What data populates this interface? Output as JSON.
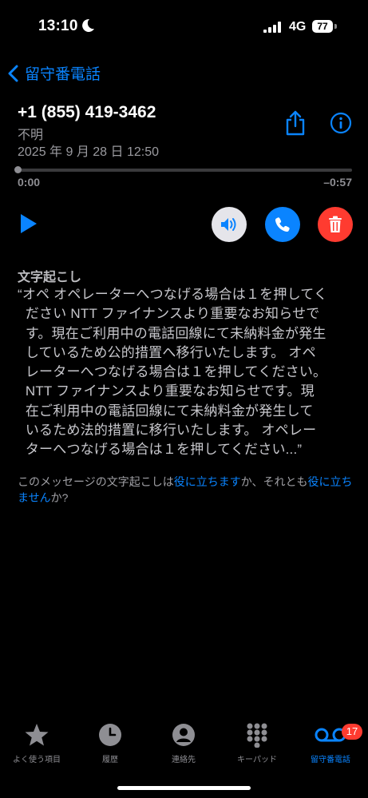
{
  "status_bar": {
    "time": "13:10",
    "network": "4G",
    "battery": "77"
  },
  "nav": {
    "back_label": "留守番電話"
  },
  "message": {
    "phone_number": "+1 (855) 419-3462",
    "caller_label": "不明",
    "date": "2025 年 9 月 28 日 12:50"
  },
  "player": {
    "elapsed": "0:00",
    "remaining": "–0:57",
    "progress": 0.0
  },
  "transcript": {
    "heading": "文字起こし",
    "text": "“オペ オペレーターへつなげる場合は１を押してく\n  ださい NTT ファイナンスより重要なお知らせで\n  す。現在ご利用中の電話回線にて未納料金が発生\n  しているため公的措置へ移行いたします。 オペ\n  レーターへつなげる場合は１を押してください。\n  NTT ファイナンスより重要なお知らせです。現\n  在ご利用中の電話回線にて未納料金が発生して\n  いるため法的措置に移行いたします。 オペレー\n  ターへつなげる場合は１を押してください...”"
  },
  "feedback": {
    "prefix": "このメッセージの文字起こしは",
    "yes_link": "役に立ちます",
    "middle": "か、それとも",
    "no_link": "役に立ちません",
    "suffix": "か?"
  },
  "tabbar": {
    "items": [
      {
        "label": "よく使う項目",
        "icon": "star-icon"
      },
      {
        "label": "履歴",
        "icon": "clock-icon"
      },
      {
        "label": "連絡先",
        "icon": "person-icon"
      },
      {
        "label": "キーパッド",
        "icon": "keypad-icon"
      },
      {
        "label": "留守番電話",
        "icon": "voicemail-icon"
      }
    ],
    "badge": "17"
  },
  "colors": {
    "accent": "#0a84ff",
    "danger": "#ff3b30",
    "muted": "#8e8e93"
  }
}
